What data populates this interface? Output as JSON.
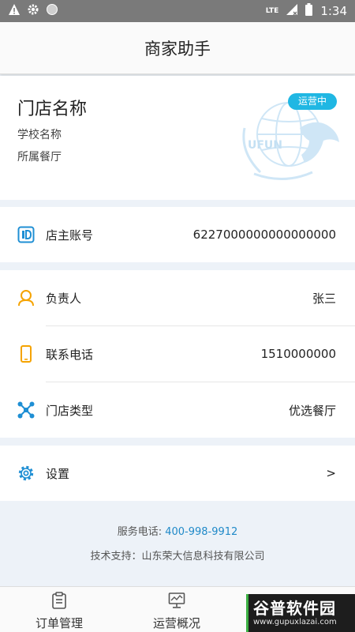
{
  "status_bar": {
    "network": "LTE",
    "time": "1:34"
  },
  "app_bar": {
    "title": "商家助手"
  },
  "store": {
    "name": "门店名称",
    "school": "学校名称",
    "canteen": "所属餐厅",
    "status_badge": "运营中",
    "logo_text": "UFUN"
  },
  "account": {
    "label": "店主账号",
    "value": "6227000000000000000"
  },
  "info_rows": [
    {
      "label": "负责人",
      "value": "张三"
    },
    {
      "label": "联系电话",
      "value": "1510000000"
    },
    {
      "label": "门店类型",
      "value": "优选餐厅"
    }
  ],
  "settings": {
    "label": "设置",
    "chevron": ">"
  },
  "footer": {
    "service_label": "服务电话:",
    "service_phone": "400-998-9912",
    "support": "技术支持：山东荣大信息科技有限公司"
  },
  "tabs": [
    {
      "label": "订单管理",
      "icon": "clipboard-icon"
    },
    {
      "label": "运营概况",
      "icon": "monitor-icon"
    }
  ],
  "watermark": {
    "title": "谷普软件园",
    "url": "www.gupuxlazai.com"
  },
  "colors": {
    "accent": "#20b7e3",
    "link": "#1f89c8",
    "icon_blue": "#1f8fd4",
    "icon_orange": "#f5a300",
    "background": "#edf2f8"
  }
}
